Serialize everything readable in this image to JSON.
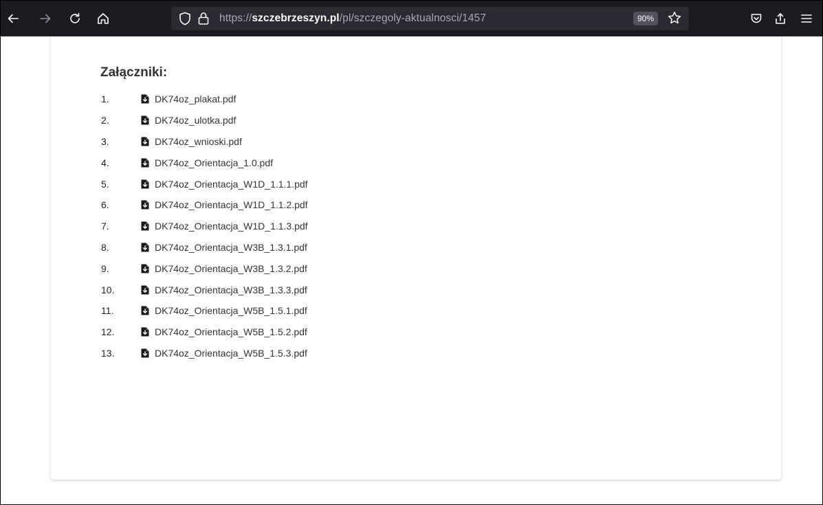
{
  "browser": {
    "url_host": "szczebrzeszyn.pl",
    "url_prefix": "https://",
    "url_path": "/pl/szczegoly-aktualnosci/1457",
    "zoom_level": "90%"
  },
  "page": {
    "attachments_heading": "Załączniki:",
    "attachments": [
      {
        "number": "1.",
        "label": "DK74oz_plakat.pdf"
      },
      {
        "number": "2.",
        "label": "DK74oz_ulotka.pdf"
      },
      {
        "number": "3.",
        "label": "DK74oz_wnioski.pdf"
      },
      {
        "number": "4.",
        "label": "DK74oz_Orientacja_1.0.pdf"
      },
      {
        "number": "5.",
        "label": "DK74oz_Orientacja_W1D_1.1.1.pdf"
      },
      {
        "number": "6.",
        "label": "DK74oz_Orientacja_W1D_1.1.2.pdf"
      },
      {
        "number": "7.",
        "label": "DK74oz_Orientacja_W1D_1.1.3.pdf"
      },
      {
        "number": "8.",
        "label": "DK74oz_Orientacja_W3B_1.3.1.pdf"
      },
      {
        "number": "9.",
        "label": "DK74oz_Orientacja_W3B_1.3.2.pdf"
      },
      {
        "number": "10.",
        "label": "DK74oz_Orientacja_W3B_1.3.3.pdf"
      },
      {
        "number": "11.",
        "label": "DK74oz_Orientacja_W5B_1.5.1.pdf"
      },
      {
        "number": "12.",
        "label": "DK74oz_Orientacja_W5B_1.5.2.pdf"
      },
      {
        "number": "13.",
        "label": "DK74oz_Orientacja_W5B_1.5.3.pdf"
      }
    ]
  },
  "icons": {
    "back": "back-arrow-icon",
    "forward": "forward-arrow-icon",
    "reload": "reload-icon",
    "home": "home-icon",
    "tracking": "shield-icon",
    "lock": "lock-icon",
    "bookmark": "star-icon",
    "pocket": "pocket-icon",
    "share": "share-icon",
    "menu": "hamburger-menu-icon",
    "attachment": "pdf-file-download-icon"
  },
  "colors": {
    "toolbar_bg": "#1c1b22",
    "urlbar_bg": "#2b2a33",
    "page_text": "#333333"
  }
}
